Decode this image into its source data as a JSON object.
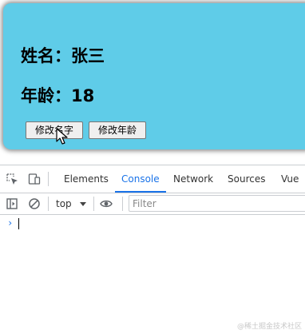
{
  "card": {
    "name_line": "姓名：张三",
    "age_line": "年龄：18",
    "change_name_button": "修改名字",
    "change_age_button": "修改年龄",
    "background_color": "#5fcce8"
  },
  "devtools": {
    "tabs": [
      {
        "label": "Elements",
        "active": false
      },
      {
        "label": "Console",
        "active": true
      },
      {
        "label": "Network",
        "active": false
      },
      {
        "label": "Sources",
        "active": false
      },
      {
        "label": "Vue",
        "active": false
      }
    ],
    "toolbar": {
      "context_value": "top",
      "filter_placeholder": "Filter"
    },
    "console": {
      "prompt": "›"
    },
    "accent_color": "#1a73e8"
  },
  "watermark": "@稀土掘金技术社区"
}
